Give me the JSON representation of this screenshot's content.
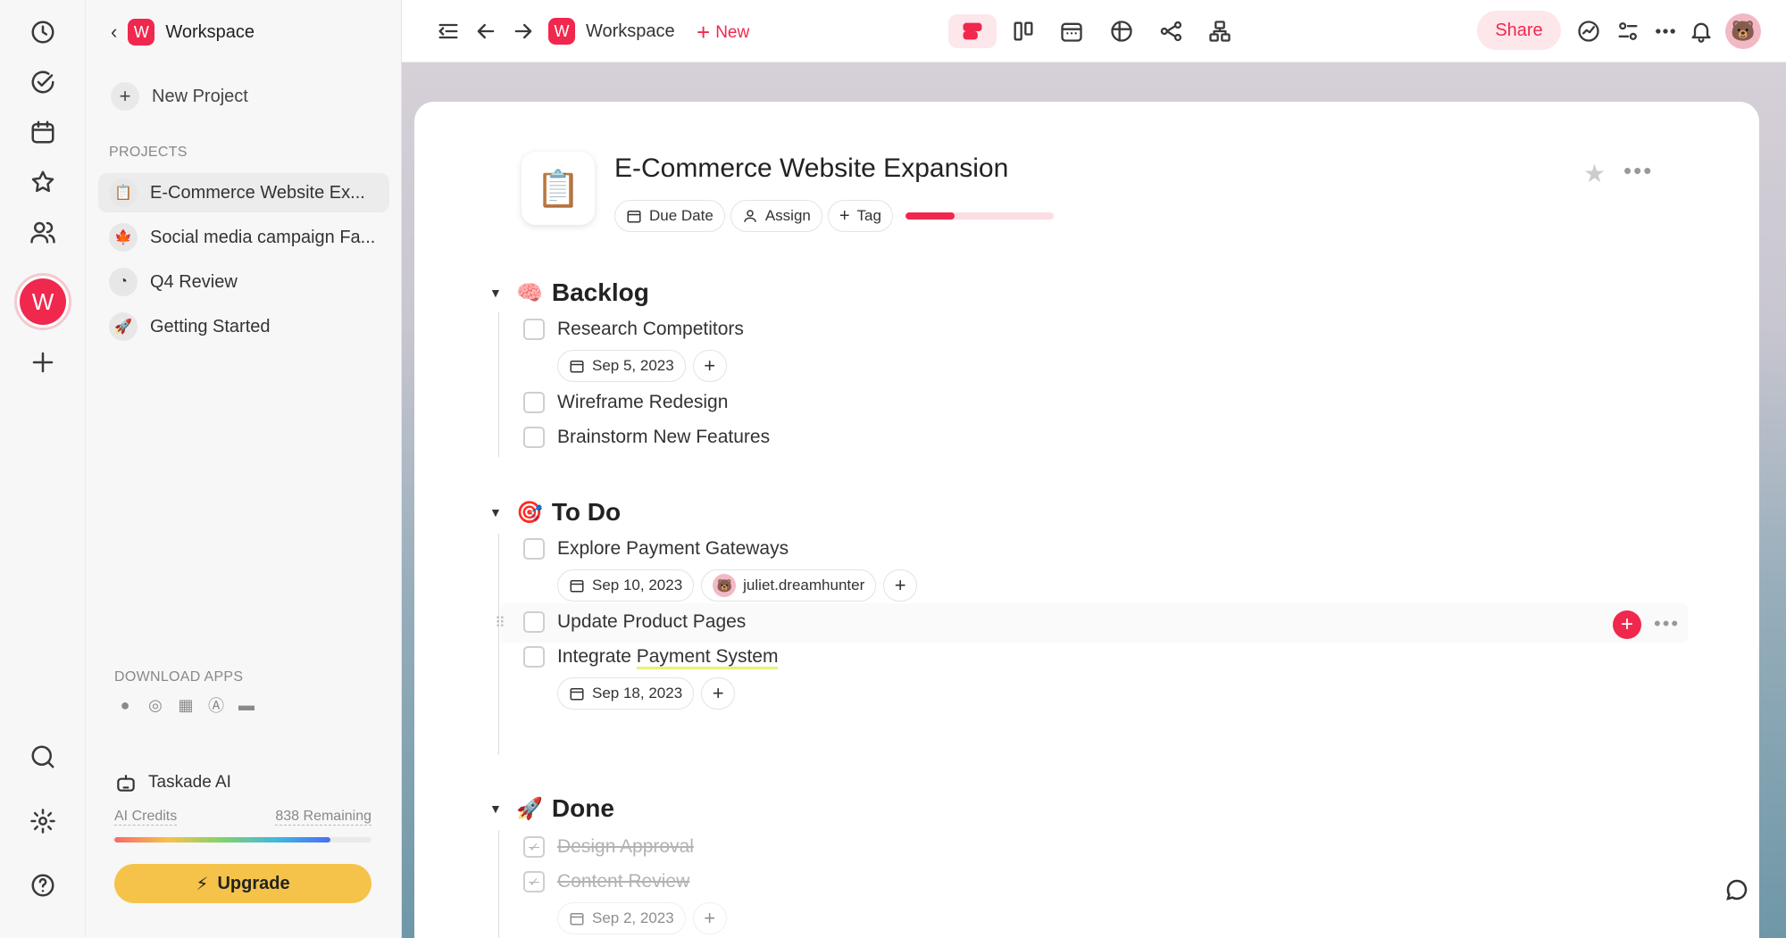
{
  "rail": {
    "workspace_initial": "W"
  },
  "sidebar": {
    "workspace_name": "Workspace",
    "workspace_initial": "W",
    "new_project_label": "New Project",
    "projects_heading": "PROJECTS",
    "projects": [
      {
        "label": "E-Commerce Website Ex...",
        "icon": "📋"
      },
      {
        "label": "Social media campaign Fa...",
        "icon": "🍁"
      },
      {
        "label": "Q4 Review",
        "icon": "◔"
      },
      {
        "label": "Getting Started",
        "icon": "🚀"
      }
    ],
    "download_heading": "DOWNLOAD APPS",
    "ai_label": "Taskade AI",
    "credits_label": "AI Credits",
    "credits_remaining": "838 Remaining",
    "credits_fraction": 0.84,
    "upgrade_label": "Upgrade"
  },
  "topbar": {
    "workspace_name": "Workspace",
    "workspace_initial": "W",
    "new_label": "New",
    "share_label": "Share"
  },
  "project": {
    "icon": "📋",
    "title": "E-Commerce Website Expansion",
    "due_date_label": "Due Date",
    "assign_label": "Assign",
    "tag_label": "Tag",
    "progress_fraction": 0.33
  },
  "sections": [
    {
      "emoji": "🧠",
      "title": "Backlog",
      "tasks": [
        {
          "label": "Research Competitors",
          "date": "Sep 5, 2023"
        },
        {
          "label": "Wireframe Redesign"
        },
        {
          "label": "Brainstorm New Features"
        }
      ]
    },
    {
      "emoji": "🎯",
      "title": "To Do",
      "tasks": [
        {
          "label": "Explore Payment Gateways",
          "date": "Sep 10, 2023",
          "assignee": "juliet.dreamhunter"
        },
        {
          "label": "Update Product Pages"
        },
        {
          "label_pre": "Integrate ",
          "label_hl": "Payment System",
          "date": "Sep 18, 2023"
        }
      ]
    },
    {
      "emoji": "🚀",
      "title": "Done",
      "tasks": [
        {
          "label": "Design Approval"
        },
        {
          "label": "Content Review",
          "date": "Sep 2, 2023"
        }
      ]
    }
  ]
}
